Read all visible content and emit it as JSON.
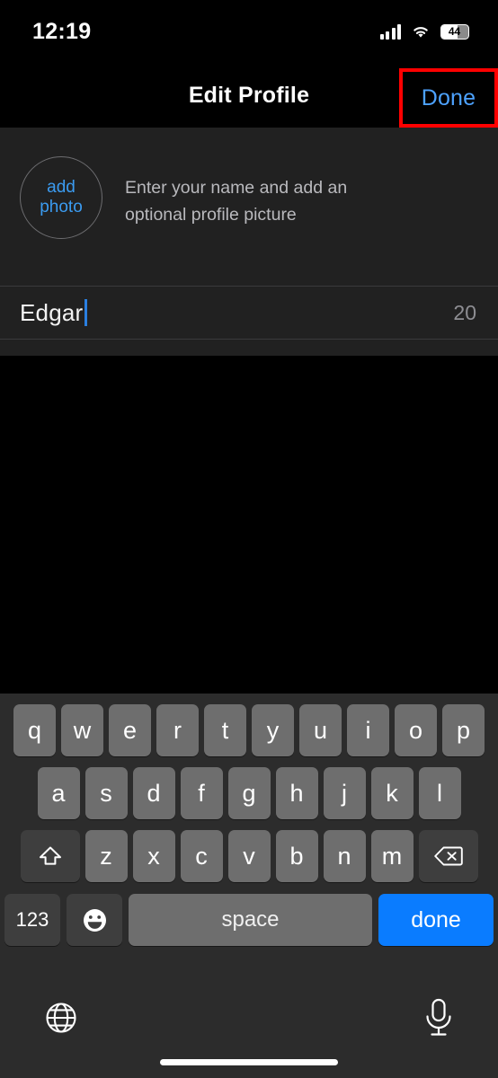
{
  "status_bar": {
    "time": "12:19",
    "signal_icon": "cellular-signal-icon",
    "wifi_icon": "wifi-icon",
    "battery_percent": "44",
    "battery_icon": "battery-icon"
  },
  "nav_bar": {
    "title": "Edit Profile",
    "done_label": "Done",
    "highlight_color": "#ff0000",
    "accent_color": "#4da2ff"
  },
  "profile": {
    "add_photo_line1": "add",
    "add_photo_line2": "photo",
    "hint": "Enter your name and add an optional profile picture",
    "add_photo_color": "#3b9bf0"
  },
  "name_field": {
    "value": "Edgar",
    "char_count": "20",
    "caret_color": "#2a7fe0"
  },
  "keyboard": {
    "row1": [
      "q",
      "w",
      "e",
      "r",
      "t",
      "y",
      "u",
      "i",
      "o",
      "p"
    ],
    "row2": [
      "a",
      "s",
      "d",
      "f",
      "g",
      "h",
      "j",
      "k",
      "l"
    ],
    "row3": [
      "z",
      "x",
      "c",
      "v",
      "b",
      "n",
      "m"
    ],
    "shift_icon": "shift-arrow-icon",
    "backspace_icon": "backspace-delete-icon",
    "numbers_label": "123",
    "emoji_icon": "emoji-smiley-icon",
    "space_label": "space",
    "done_label": "done",
    "done_color": "#0a7cff",
    "globe_icon": "globe-language-icon",
    "mic_icon": "microphone-dictation-icon"
  }
}
